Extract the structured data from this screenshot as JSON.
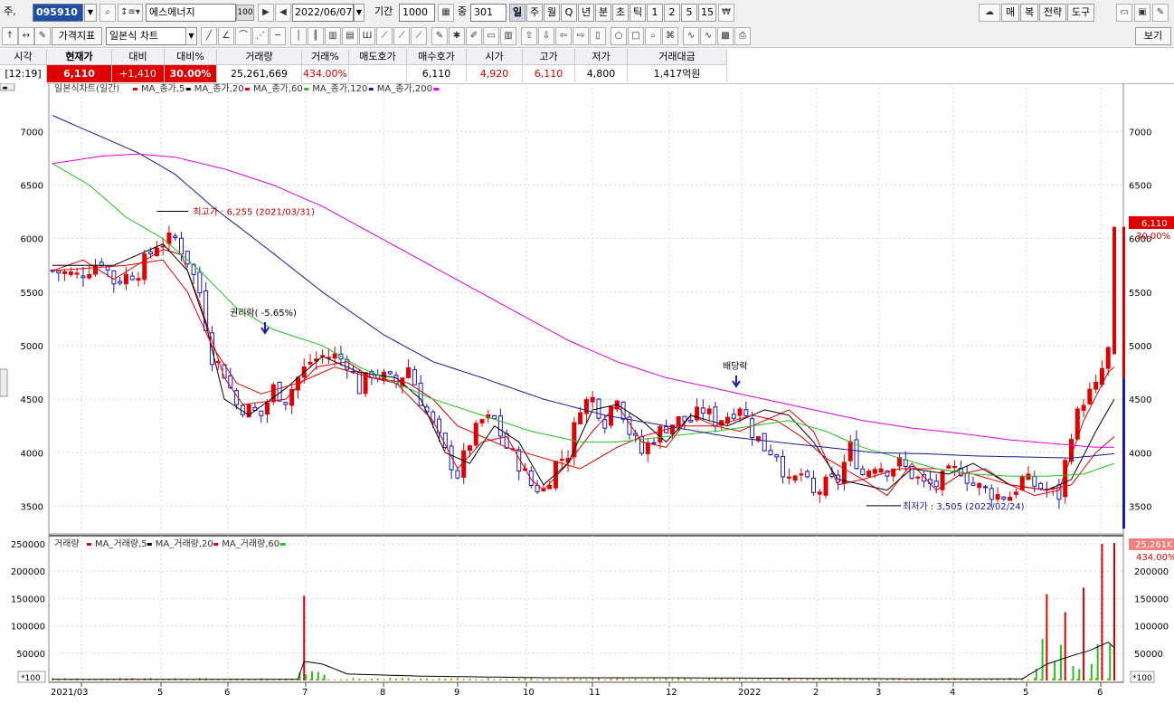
{
  "toolbar": {
    "prefix": "주,",
    "code": "095910",
    "name": "에스에너지",
    "name_badge": "100",
    "date": "2022/06/07",
    "period_label": "기간",
    "period_value": "1000",
    "count_label": "중",
    "count_value": "301",
    "periods": [
      "일",
      "주",
      "월",
      "Q",
      "년",
      "분",
      "초",
      "틱",
      "1",
      "2",
      "5",
      "15"
    ],
    "active_period": "일",
    "right_buttons": [
      "매",
      "복",
      "전략",
      "도구"
    ],
    "indicator_button": "가격지표",
    "chart_type": "일본식 차트",
    "view_button": "보기"
  },
  "quote": {
    "headers": [
      "시각",
      "현재가",
      "대비",
      "대비%",
      "거래량",
      "거래%",
      "매도호가",
      "매수호가",
      "시가",
      "고가",
      "저가",
      "거래대금"
    ],
    "values": [
      "[12:19]",
      "6,110",
      "+1,410",
      "30.00%",
      "25,261,669",
      "434.00%",
      "",
      "6,110",
      "4,920",
      "6,110",
      "4,800",
      "1,417억원"
    ]
  },
  "price_chart": {
    "title": "일본식차트(일간)",
    "ma_legend": [
      {
        "name": "MA_종가,5",
        "color": "#e00000"
      },
      {
        "name": "MA_종가,20",
        "color": "#000000"
      },
      {
        "name": "MA_종가,60",
        "color": "#e00000"
      },
      {
        "name": "MA_종가,120",
        "color": "#22c022"
      },
      {
        "name": "MA_종가,200",
        "color": "#1a1a8c"
      }
    ],
    "end_color": "#e000e0",
    "annotations": {
      "high": "최고가 : 6,255 (2021/03/31)",
      "low": "최저가 : 3,505 (2022/02/24)",
      "rights": "권리락( -5.65%)",
      "dividend": "배당락"
    },
    "last_price_tag": "6,110",
    "last_pct_tag": "30.00%"
  },
  "volume_chart": {
    "title": "거래량",
    "ma_legend": [
      {
        "name": "MA_거래량,5",
        "color": "#e00000"
      },
      {
        "name": "MA_거래량,20",
        "color": "#000000"
      },
      {
        "name": "MA_거래량,60",
        "color": "#e00000"
      }
    ],
    "end_color": "#22c022",
    "last_volume_tag": "25,261K",
    "last_pct_tag": "434.00%",
    "unit": "*100"
  },
  "chart_data": {
    "type": "candlestick",
    "y_price": {
      "ylim": [
        3250,
        7400
      ],
      "ticks": [
        3500,
        4000,
        4500,
        5000,
        5500,
        6000,
        6500,
        7000
      ]
    },
    "y_volume": {
      "ylim": [
        0,
        260000
      ],
      "ticks": [
        50000,
        100000,
        150000,
        200000,
        250000
      ]
    },
    "x_ticks": [
      "2021/03",
      "5",
      "6",
      "7",
      "8",
      "9",
      "10",
      "11",
      "12",
      "2022",
      "2",
      "3",
      "4",
      "5",
      "6"
    ],
    "ma_points": {
      "ma5_red": [
        [
          0,
          5700
        ],
        [
          5,
          5800
        ],
        [
          10,
          5620
        ],
        [
          18,
          5900
        ],
        [
          21,
          5850
        ],
        [
          24,
          5400
        ],
        [
          28,
          4700
        ],
        [
          31,
          4450
        ],
        [
          38,
          4500
        ],
        [
          43,
          4800
        ],
        [
          48,
          4850
        ],
        [
          52,
          4700
        ],
        [
          56,
          4650
        ],
        [
          62,
          4300
        ],
        [
          66,
          3850
        ],
        [
          70,
          4100
        ],
        [
          74,
          4150
        ],
        [
          78,
          3750
        ],
        [
          80,
          3650
        ],
        [
          84,
          3900
        ],
        [
          88,
          4200
        ],
        [
          92,
          4450
        ],
        [
          96,
          4100
        ],
        [
          100,
          4050
        ],
        [
          104,
          4350
        ],
        [
          108,
          4250
        ],
        [
          112,
          4200
        ],
        [
          116,
          4300
        ],
        [
          120,
          4400
        ],
        [
          124,
          4200
        ],
        [
          128,
          3700
        ],
        [
          132,
          3750
        ],
        [
          136,
          3600
        ],
        [
          140,
          3900
        ],
        [
          144,
          3650
        ],
        [
          148,
          3800
        ],
        [
          152,
          3850
        ],
        [
          156,
          3700
        ],
        [
          160,
          3600
        ],
        [
          164,
          3650
        ],
        [
          168,
          4300
        ],
        [
          172,
          4750
        ],
        [
          173,
          4800
        ]
      ],
      "ma20_black": [
        [
          0,
          5750
        ],
        [
          10,
          5750
        ],
        [
          18,
          5950
        ],
        [
          22,
          5700
        ],
        [
          25,
          5200
        ],
        [
          28,
          4500
        ],
        [
          32,
          4350
        ],
        [
          38,
          4600
        ],
        [
          44,
          4900
        ],
        [
          50,
          4750
        ],
        [
          56,
          4700
        ],
        [
          60,
          4500
        ],
        [
          64,
          4000
        ],
        [
          68,
          3900
        ],
        [
          72,
          4250
        ],
        [
          76,
          4100
        ],
        [
          80,
          3700
        ],
        [
          84,
          3900
        ],
        [
          88,
          4400
        ],
        [
          92,
          4450
        ],
        [
          96,
          4300
        ],
        [
          100,
          4100
        ],
        [
          104,
          4350
        ],
        [
          110,
          4250
        ],
        [
          116,
          4400
        ],
        [
          120,
          4350
        ],
        [
          124,
          4100
        ],
        [
          128,
          3750
        ],
        [
          132,
          3700
        ],
        [
          136,
          3650
        ],
        [
          140,
          3850
        ],
        [
          146,
          3800
        ],
        [
          150,
          3900
        ],
        [
          156,
          3700
        ],
        [
          162,
          3650
        ],
        [
          166,
          3750
        ],
        [
          170,
          4200
        ],
        [
          173,
          4500
        ]
      ],
      "ma60_red": [
        [
          0,
          5700
        ],
        [
          12,
          5750
        ],
        [
          18,
          5800
        ],
        [
          22,
          5500
        ],
        [
          26,
          5000
        ],
        [
          30,
          4650
        ],
        [
          34,
          4550
        ],
        [
          40,
          4650
        ],
        [
          46,
          4800
        ],
        [
          52,
          4700
        ],
        [
          58,
          4650
        ],
        [
          62,
          4500
        ],
        [
          66,
          4250
        ],
        [
          70,
          4150
        ],
        [
          74,
          4050
        ],
        [
          80,
          3950
        ],
        [
          86,
          3850
        ],
        [
          92,
          4050
        ],
        [
          96,
          4150
        ],
        [
          102,
          4250
        ],
        [
          108,
          4250
        ],
        [
          114,
          4350
        ],
        [
          118,
          4300
        ],
        [
          122,
          4150
        ],
        [
          126,
          3950
        ],
        [
          132,
          3750
        ],
        [
          138,
          3850
        ],
        [
          144,
          3850
        ],
        [
          150,
          3800
        ],
        [
          156,
          3700
        ],
        [
          162,
          3650
        ],
        [
          166,
          3700
        ],
        [
          170,
          4000
        ],
        [
          173,
          4150
        ]
      ],
      "ma120_green": [
        [
          0,
          6700
        ],
        [
          6,
          6500
        ],
        [
          12,
          6200
        ],
        [
          18,
          6000
        ],
        [
          24,
          5700
        ],
        [
          30,
          5350
        ],
        [
          36,
          5150
        ],
        [
          44,
          5000
        ],
        [
          50,
          4800
        ],
        [
          56,
          4650
        ],
        [
          62,
          4500
        ],
        [
          70,
          4350
        ],
        [
          78,
          4200
        ],
        [
          86,
          4100
        ],
        [
          92,
          4100
        ],
        [
          100,
          4150
        ],
        [
          108,
          4200
        ],
        [
          114,
          4250
        ],
        [
          120,
          4300
        ],
        [
          126,
          4200
        ],
        [
          132,
          4050
        ],
        [
          138,
          3950
        ],
        [
          144,
          3850
        ],
        [
          150,
          3800
        ],
        [
          156,
          3780
        ],
        [
          162,
          3780
        ],
        [
          168,
          3800
        ],
        [
          173,
          3900
        ]
      ],
      "ma200_navy": [
        [
          0,
          7150
        ],
        [
          8,
          6950
        ],
        [
          14,
          6800
        ],
        [
          20,
          6600
        ],
        [
          26,
          6300
        ],
        [
          34,
          5950
        ],
        [
          44,
          5500
        ],
        [
          54,
          5100
        ],
        [
          62,
          4850
        ],
        [
          70,
          4700
        ],
        [
          80,
          4500
        ],
        [
          90,
          4350
        ],
        [
          100,
          4250
        ],
        [
          110,
          4150
        ],
        [
          118,
          4100
        ],
        [
          126,
          4050
        ],
        [
          134,
          4000
        ],
        [
          142,
          3990
        ],
        [
          150,
          3970
        ],
        [
          158,
          3960
        ],
        [
          166,
          3950
        ],
        [
          173,
          3990
        ]
      ],
      "ma_last_magenta": [
        [
          0,
          6700
        ],
        [
          8,
          6770
        ],
        [
          14,
          6790
        ],
        [
          20,
          6760
        ],
        [
          28,
          6650
        ],
        [
          36,
          6500
        ],
        [
          44,
          6300
        ],
        [
          52,
          6050
        ],
        [
          60,
          5800
        ],
        [
          68,
          5550
        ],
        [
          76,
          5300
        ],
        [
          84,
          5050
        ],
        [
          92,
          4850
        ],
        [
          100,
          4700
        ],
        [
          108,
          4600
        ],
        [
          116,
          4500
        ],
        [
          124,
          4400
        ],
        [
          132,
          4300
        ],
        [
          140,
          4230
        ],
        [
          148,
          4180
        ],
        [
          156,
          4120
        ],
        [
          164,
          4080
        ],
        [
          170,
          4050
        ],
        [
          173,
          4050
        ]
      ]
    },
    "candle_anchors": [
      [
        0,
        5700
      ],
      [
        4,
        5650
      ],
      [
        8,
        5800
      ],
      [
        10,
        5600
      ],
      [
        14,
        5700
      ],
      [
        17,
        5950
      ],
      [
        20,
        6000
      ],
      [
        22,
        5800
      ],
      [
        24,
        5500
      ],
      [
        26,
        4900
      ],
      [
        28,
        4750
      ],
      [
        30,
        4450
      ],
      [
        32,
        4400
      ],
      [
        34,
        4350
      ],
      [
        36,
        4600
      ],
      [
        38,
        4500
      ],
      [
        40,
        4700
      ],
      [
        42,
        4850
      ],
      [
        44,
        4900
      ],
      [
        46,
        4900
      ],
      [
        48,
        4850
      ],
      [
        50,
        4600
      ],
      [
        52,
        4750
      ],
      [
        54,
        4700
      ],
      [
        56,
        4650
      ],
      [
        58,
        4800
      ],
      [
        60,
        4500
      ],
      [
        62,
        4250
      ],
      [
        64,
        4000
      ],
      [
        66,
        3800
      ],
      [
        68,
        4100
      ],
      [
        70,
        4300
      ],
      [
        72,
        4300
      ],
      [
        74,
        4050
      ],
      [
        76,
        3900
      ],
      [
        78,
        3700
      ],
      [
        80,
        3650
      ],
      [
        82,
        3900
      ],
      [
        84,
        4000
      ],
      [
        86,
        4450
      ],
      [
        88,
        4500
      ],
      [
        90,
        4300
      ],
      [
        92,
        4550
      ],
      [
        94,
        4200
      ],
      [
        96,
        4000
      ],
      [
        98,
        4150
      ],
      [
        100,
        4250
      ],
      [
        102,
        4300
      ],
      [
        104,
        4300
      ],
      [
        106,
        4400
      ],
      [
        108,
        4300
      ],
      [
        110,
        4350
      ],
      [
        112,
        4450
      ],
      [
        114,
        4200
      ],
      [
        116,
        4050
      ],
      [
        118,
        4000
      ],
      [
        120,
        3700
      ],
      [
        122,
        3800
      ],
      [
        124,
        3600
      ],
      [
        126,
        3700
      ],
      [
        128,
        3750
      ],
      [
        130,
        4050
      ],
      [
        132,
        3800
      ],
      [
        134,
        3900
      ],
      [
        136,
        3850
      ],
      [
        138,
        3900
      ],
      [
        140,
        3800
      ],
      [
        142,
        3700
      ],
      [
        144,
        3700
      ],
      [
        146,
        3800
      ],
      [
        148,
        3850
      ],
      [
        150,
        3700
      ],
      [
        152,
        3650
      ],
      [
        154,
        3600
      ],
      [
        156,
        3600
      ],
      [
        158,
        3750
      ],
      [
        160,
        3700
      ],
      [
        162,
        3650
      ],
      [
        164,
        3600
      ],
      [
        166,
        4200
      ],
      [
        168,
        4500
      ],
      [
        170,
        4600
      ],
      [
        172,
        4950
      ],
      [
        173,
        6110
      ]
    ],
    "volume_spikes": [
      [
        41,
        155000
      ],
      [
        120,
        4000
      ],
      [
        162,
        158000
      ],
      [
        165,
        125000
      ],
      [
        168,
        170000
      ],
      [
        171,
        250000
      ],
      [
        173,
        252000
      ]
    ],
    "volume_baseline": 5000
  }
}
